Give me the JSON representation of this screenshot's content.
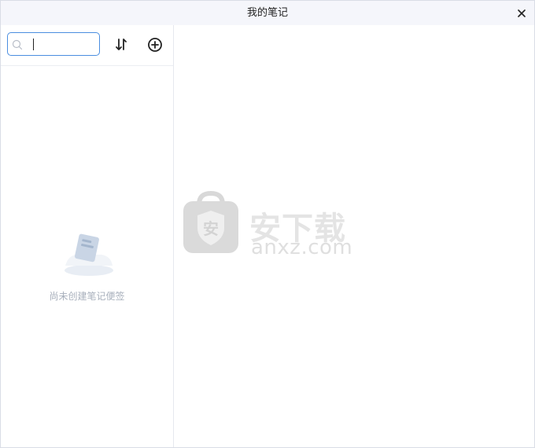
{
  "window": {
    "title": "我的笔记",
    "close_icon": "close-icon"
  },
  "sidebar": {
    "search": {
      "value": "",
      "placeholder": "",
      "icon": "search-icon"
    },
    "sort_icon": "sort-icon",
    "add_icon": "add-circle-icon",
    "empty_text": "尚未创建笔记便签"
  },
  "watermark": {
    "text_cn": "安下载",
    "text_en": "anxz.com"
  },
  "colors": {
    "accent": "#4a8ee0",
    "titlebar_bg": "#f5f6fb",
    "empty_text": "#a8b0bc"
  }
}
